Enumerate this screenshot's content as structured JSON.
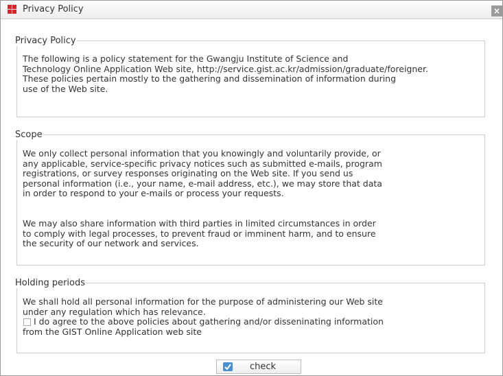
{
  "window": {
    "title": "Privacy Policy",
    "close_label": "×"
  },
  "sections": [
    {
      "legend": "Privacy Policy",
      "lines": [
        "The following is a policy statement for the Gwangju Institute of Science and",
        "Technology Online Application Web site, http://service.gist.ac.kr/admission/graduate/foreigner.",
        "These policies pertain mostly to the gathering and dissemination of information during",
        "use of the Web site."
      ]
    },
    {
      "legend": "Scope",
      "lines": [
        "We only collect personal information that you knowingly and voluntarily provide, or",
        "any applicable, service-specific privacy notices such as submitted e-mails, program",
        "registrations, or survey responses originating on the Web site. If you send us",
        "personal information (i.e., your name, e-mail address, etc.), we may store that data",
        "in order to respond to your e-mails or process your requests.",
        "We may also share information with third parties in limited circumstances in order",
        "to comply with legal processes, to prevent fraud or imminent harm, and to ensure",
        "the security of our network and services."
      ]
    },
    {
      "legend": "Holding periods",
      "lines": [
        "We shall hold all personal information for the purpose of administering our Web site",
        "under any regulation which has relevance."
      ],
      "agree_line1": "I do agree to the above policies about gathering and/or disseninating information",
      "agree_line2": "from the GIST Online Application web site",
      "agree_checked": false
    }
  ],
  "footer": {
    "check_label": "check"
  },
  "colors": {
    "app_icon": "#d8232a",
    "check_icon": "#4a8fd4"
  },
  "icons": {
    "app": "windows-grid-icon",
    "close": "close-icon",
    "check": "check-icon"
  }
}
